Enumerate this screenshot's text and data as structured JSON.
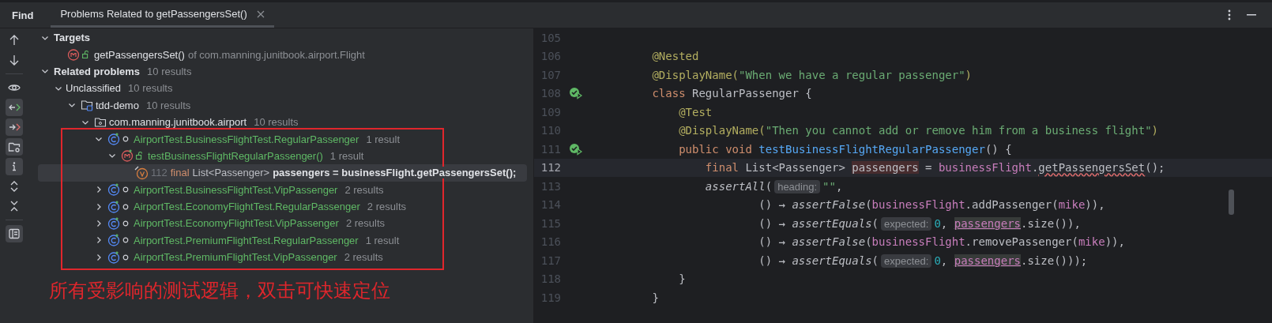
{
  "header": {
    "title": "Find",
    "tabs": [
      {
        "label": "Problems Related to getPassengersSet()",
        "selected": true,
        "closable": true
      }
    ]
  },
  "toolbar": [
    {
      "kind": "up",
      "on": false
    },
    {
      "kind": "down",
      "on": false
    },
    {
      "kind": "eye",
      "on": false
    },
    {
      "kind": "incoming",
      "on": true
    },
    {
      "kind": "outgoing",
      "on": true
    },
    {
      "kind": "folder-settings",
      "on": true
    },
    {
      "kind": "info",
      "on": true
    },
    {
      "kind": "expand",
      "on": false
    },
    {
      "kind": "collapse",
      "on": false
    },
    {
      "kind": "preview",
      "on": true
    }
  ],
  "tree": [
    {
      "kind": "section",
      "label": "Targets",
      "expanded": true,
      "selected": false,
      "children": [
        {
          "kind": "method",
          "public": true,
          "label": "getPassengersSet()",
          "detail": "of com.manning.junitbook.airport.Flight",
          "selected": false
        }
      ]
    },
    {
      "kind": "section",
      "label": "Related problems",
      "count": "10 results",
      "expanded": true,
      "selected": false,
      "children": [
        {
          "kind": "group",
          "label": "Unclassified",
          "count": "10 results",
          "expanded": true,
          "selected": false,
          "children": [
            {
              "kind": "module",
              "label": "tdd-demo",
              "count": "10 results",
              "expanded": true,
              "selected": false,
              "children": [
                {
                  "kind": "package",
                  "label": "com.manning.junitbook.airport",
                  "count": "10 results",
                  "expanded": true,
                  "selected": false,
                  "boxed": true,
                  "children": [
                    {
                      "kind": "test-class",
                      "public": false,
                      "label": "AirportTest.BusinessFlightTest.RegularPassenger",
                      "count": "1 result",
                      "expanded": true,
                      "selected": false,
                      "children": [
                        {
                          "kind": "test-method",
                          "public": true,
                          "label": "testBusinessFlightRegularPassenger()",
                          "count": "1 result",
                          "expanded": true,
                          "selected": false,
                          "children": [
                            {
                              "kind": "usage",
                              "line": "112",
                              "code": [
                                {
                                  "text": "final",
                                  "kind": "keyword"
                                },
                                {
                                  "text": "List<Passenger>",
                                  "kind": "plain"
                                },
                                {
                                  "text": "passengers = businessFlight.getPassengersSet();",
                                  "kind": "bold"
                                }
                              ],
                              "selected": true
                            }
                          ]
                        }
                      ]
                    },
                    {
                      "kind": "test-class",
                      "public": false,
                      "label": "AirportTest.BusinessFlightTest.VipPassenger",
                      "count": "2 results",
                      "expanded": false,
                      "selected": false
                    },
                    {
                      "kind": "test-class",
                      "public": false,
                      "label": "AirportTest.EconomyFlightTest.RegularPassenger",
                      "count": "2 results",
                      "expanded": false,
                      "selected": false
                    },
                    {
                      "kind": "test-class",
                      "public": false,
                      "label": "AirportTest.EconomyFlightTest.VipPassenger",
                      "count": "2 results",
                      "expanded": false,
                      "selected": false
                    },
                    {
                      "kind": "test-class",
                      "public": false,
                      "label": "AirportTest.PremiumFlightTest.RegularPassenger",
                      "count": "1 result",
                      "expanded": false,
                      "selected": false
                    },
                    {
                      "kind": "test-class",
                      "public": false,
                      "label": "AirportTest.PremiumFlightTest.VipPassenger",
                      "count": "2 results",
                      "expanded": false,
                      "selected": false
                    }
                  ]
                }
              ]
            }
          ]
        }
      ]
    }
  ],
  "annotation": {
    "caption": "所有受影响的测试逻辑，双击可快速定位"
  },
  "editor": {
    "lines": [
      {
        "num": "105",
        "current": false
      },
      {
        "num": "106",
        "current": false,
        "tokens": [
          {
            "text": "        @Nested",
            "kind": "annotation"
          }
        ]
      },
      {
        "num": "107",
        "current": false,
        "tokens": [
          {
            "text": "        @DisplayName(",
            "kind": "annotation"
          },
          {
            "text": "\"When we have a regular passenger\"",
            "kind": "string"
          },
          {
            "text": ")",
            "kind": "annotation"
          }
        ]
      },
      {
        "num": "108",
        "current": false,
        "run_marker": true,
        "tokens": [
          {
            "text": "        class",
            "kind": "keyword"
          },
          {
            "text": " RegularPassenger {",
            "kind": "plain"
          }
        ]
      },
      {
        "num": "109",
        "current": false,
        "tokens": [
          {
            "text": "            @Test",
            "kind": "annotation"
          }
        ]
      },
      {
        "num": "110",
        "current": false,
        "tokens": [
          {
            "text": "            @DisplayName(",
            "kind": "annotation"
          },
          {
            "text": "\"Then you cannot add or remove him from a business flight\"",
            "kind": "string"
          },
          {
            "text": ")",
            "kind": "annotation"
          }
        ]
      },
      {
        "num": "111",
        "current": false,
        "run_marker": true,
        "tokens": [
          {
            "text": "            public void",
            "kind": "keyword"
          },
          {
            "text": " testBusinessFlightRegularPassenger",
            "kind": "decl"
          },
          {
            "text": "() {",
            "kind": "plain"
          }
        ]
      },
      {
        "num": "112",
        "current": true,
        "tokens": [
          {
            "text": "                final",
            "kind": "keyword"
          },
          {
            "text": " List<Passenger> ",
            "kind": "plain"
          },
          {
            "text": "passengers",
            "kind": "write"
          },
          {
            "text": " = ",
            "kind": "plain"
          },
          {
            "text": "businessFlight",
            "kind": "field"
          },
          {
            "text": ".",
            "kind": "plain"
          },
          {
            "text": "getPassengersSet",
            "kind": "warn"
          },
          {
            "text": "();",
            "kind": "plain"
          }
        ]
      },
      {
        "num": "113",
        "current": false,
        "tokens": [
          {
            "text": "                assertAll",
            "kind": "call"
          },
          {
            "text": "(",
            "kind": "plain"
          },
          {
            "text": "heading:",
            "kind": "hint"
          },
          {
            "text": "\"\"",
            "kind": "string"
          },
          {
            "text": ",",
            "kind": "plain"
          }
        ]
      },
      {
        "num": "114",
        "current": false,
        "tokens": [
          {
            "text": "                        () → ",
            "kind": "plain"
          },
          {
            "text": "assertFalse",
            "kind": "call"
          },
          {
            "text": "(",
            "kind": "plain"
          },
          {
            "text": "businessFlight",
            "kind": "field"
          },
          {
            "text": ".addPassenger(",
            "kind": "plain"
          },
          {
            "text": "mike",
            "kind": "field"
          },
          {
            "text": ")),",
            "kind": "plain"
          }
        ]
      },
      {
        "num": "115",
        "current": false,
        "tokens": [
          {
            "text": "                        () → ",
            "kind": "plain"
          },
          {
            "text": "assertEquals",
            "kind": "call"
          },
          {
            "text": "(",
            "kind": "plain"
          },
          {
            "text": "expected:",
            "kind": "hint"
          },
          {
            "text": "0",
            "kind": "number"
          },
          {
            "text": ", ",
            "kind": "plain"
          },
          {
            "text": "passengers",
            "kind": "usage"
          },
          {
            "text": ".size()),",
            "kind": "plain"
          }
        ]
      },
      {
        "num": "116",
        "current": false,
        "tokens": [
          {
            "text": "                        () → ",
            "kind": "plain"
          },
          {
            "text": "assertFalse",
            "kind": "call"
          },
          {
            "text": "(",
            "kind": "plain"
          },
          {
            "text": "businessFlight",
            "kind": "field"
          },
          {
            "text": ".removePassenger(",
            "kind": "plain"
          },
          {
            "text": "mike",
            "kind": "field"
          },
          {
            "text": ")),",
            "kind": "plain"
          }
        ]
      },
      {
        "num": "117",
        "current": false,
        "tokens": [
          {
            "text": "                        () → ",
            "kind": "plain"
          },
          {
            "text": "assertEquals",
            "kind": "call"
          },
          {
            "text": "(",
            "kind": "plain"
          },
          {
            "text": "expected:",
            "kind": "hint"
          },
          {
            "text": "0",
            "kind": "number"
          },
          {
            "text": ", ",
            "kind": "plain"
          },
          {
            "text": "passengers",
            "kind": "usage"
          },
          {
            "text": ".size()));",
            "kind": "plain"
          }
        ]
      },
      {
        "num": "118",
        "current": false,
        "tokens": [
          {
            "text": "            }",
            "kind": "plain"
          }
        ]
      },
      {
        "num": "119",
        "current": false,
        "tokens": [
          {
            "text": "        }",
            "kind": "plain"
          }
        ]
      }
    ]
  }
}
